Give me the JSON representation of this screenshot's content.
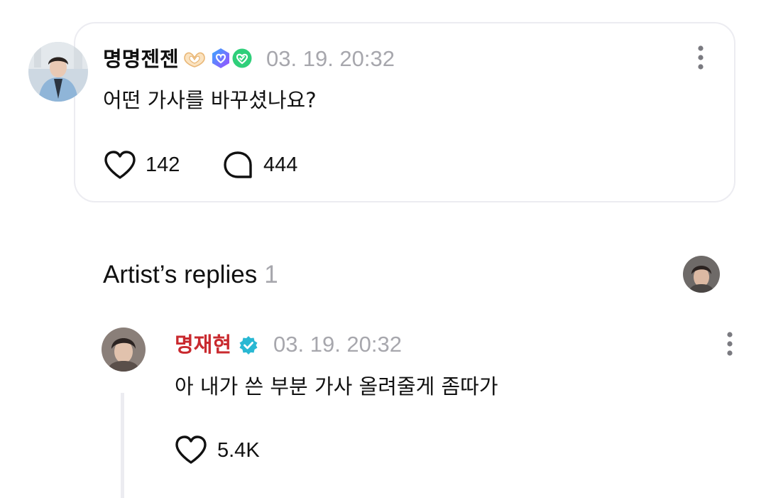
{
  "post": {
    "author": "명명젠젠",
    "timestamp": "03. 19. 20:32",
    "body": "어떤 가사를 바꾸셨나요?",
    "like_count": "142",
    "comment_count": "444",
    "icons": {
      "author_emoji": "heart-hands-icon",
      "badge_1": "membership-badge-icon",
      "badge_2": "verified-check-badge-icon",
      "more": "more-vertical-icon",
      "like": "heart-outline-icon",
      "comment": "comment-bubble-icon"
    }
  },
  "artist_replies": {
    "title": "Artist’s replies",
    "count": "1"
  },
  "reply": {
    "author": "명재현",
    "timestamp": "03. 19. 20:32",
    "body": "아 내가 쓴 부분 가사 올려줄게 좀따가",
    "like_count": "5.4K",
    "icons": {
      "verified": "verified-badge-icon",
      "more": "more-vertical-icon",
      "like": "heart-outline-icon"
    }
  },
  "colors": {
    "artist_name": "#c9292e",
    "timestamp": "#a7a7ad",
    "verified": "#29b8d3",
    "card_border": "#ececf1"
  }
}
